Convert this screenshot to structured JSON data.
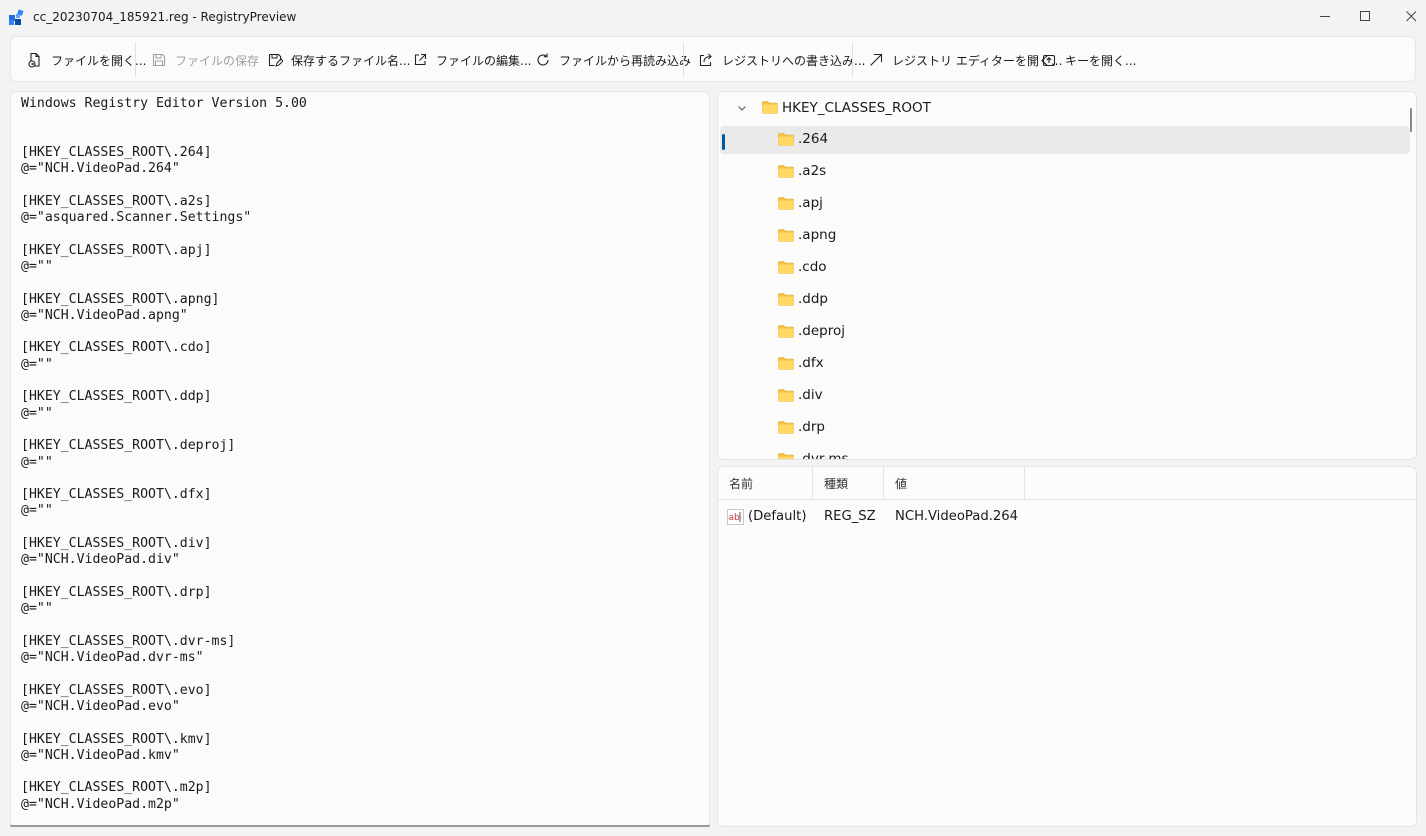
{
  "window": {
    "title": "cc_20230704_185921.reg - RegistryPreview",
    "minimize_glyph": "—",
    "maximize_glyph": "☐",
    "close_glyph": "✕"
  },
  "toolbar": {
    "open_file": "ファイルを開く...",
    "save_file": "ファイルの保存",
    "save_as": "保存するファイル名...",
    "edit_file": "ファイルの編集...",
    "reload": "ファイルから再読み込み",
    "write_registry": "レジストリへの書き込み...",
    "open_regedit": "レジストリ エディターを開く...",
    "open_key": "キーを開く..."
  },
  "editor": {
    "lines": [
      "Windows Registry Editor Version 5.00",
      "",
      "",
      "[HKEY_CLASSES_ROOT\\.264]",
      "@=\"NCH.VideoPad.264\"",
      "",
      "[HKEY_CLASSES_ROOT\\.a2s]",
      "@=\"asquared.Scanner.Settings\"",
      "",
      "[HKEY_CLASSES_ROOT\\.apj]",
      "@=\"\"",
      "",
      "[HKEY_CLASSES_ROOT\\.apng]",
      "@=\"NCH.VideoPad.apng\"",
      "",
      "[HKEY_CLASSES_ROOT\\.cdo]",
      "@=\"\"",
      "",
      "[HKEY_CLASSES_ROOT\\.ddp]",
      "@=\"\"",
      "",
      "[HKEY_CLASSES_ROOT\\.deproj]",
      "@=\"\"",
      "",
      "[HKEY_CLASSES_ROOT\\.dfx]",
      "@=\"\"",
      "",
      "[HKEY_CLASSES_ROOT\\.div]",
      "@=\"NCH.VideoPad.div\"",
      "",
      "[HKEY_CLASSES_ROOT\\.drp]",
      "@=\"\"",
      "",
      "[HKEY_CLASSES_ROOT\\.dvr-ms]",
      "@=\"NCH.VideoPad.dvr-ms\"",
      "",
      "[HKEY_CLASSES_ROOT\\.evo]",
      "@=\"NCH.VideoPad.evo\"",
      "",
      "[HKEY_CLASSES_ROOT\\.kmv]",
      "@=\"NCH.VideoPad.kmv\"",
      "",
      "[HKEY_CLASSES_ROOT\\.m2p]",
      "@=\"NCH.VideoPad.m2p\""
    ]
  },
  "tree": {
    "root": "HKEY_CLASSES_ROOT",
    "items": [
      ".264",
      ".a2s",
      ".apj",
      ".apng",
      ".cdo",
      ".ddp",
      ".deproj",
      ".dfx",
      ".div",
      ".drp",
      ".dvr-ms"
    ],
    "selected_index": 0
  },
  "values": {
    "headers": {
      "name": "名前",
      "type": "種類",
      "value": "値"
    },
    "rows": [
      {
        "name": "(Default)",
        "type": "REG_SZ",
        "value": "NCH.VideoPad.264"
      }
    ]
  },
  "colors": {
    "accent": "#005a9e",
    "folder": "#f5c542",
    "background": "#f3f3f3",
    "pane": "#fbfbfb"
  }
}
